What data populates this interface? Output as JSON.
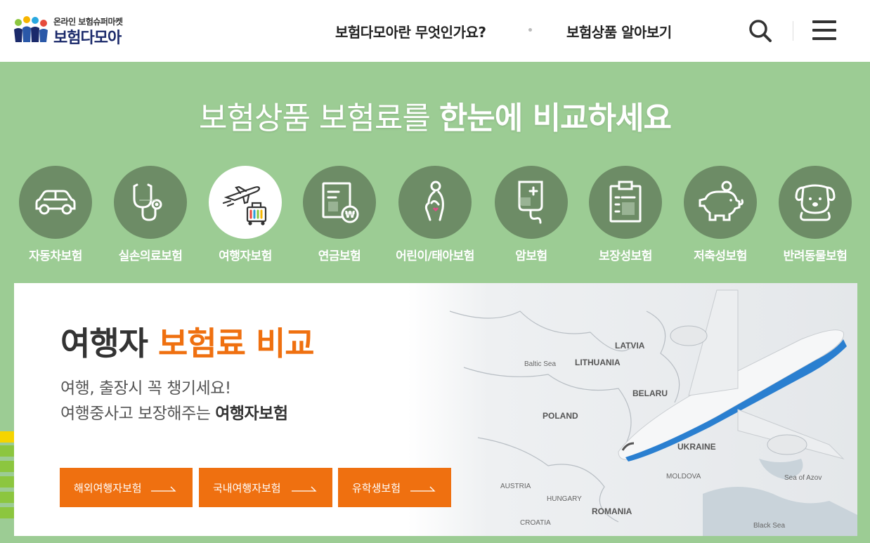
{
  "header": {
    "logo_sub": "온라인 보험슈퍼마켓",
    "logo_main": "보험다모아",
    "nav": [
      "보험다모아란 무엇인가요?",
      "보험상품 알아보기"
    ]
  },
  "hero": {
    "headline_light": "보험상품 보험료를 ",
    "headline_bold": "한눈에 비교하세요"
  },
  "categories": [
    {
      "label": "자동차보험",
      "icon": "car-icon"
    },
    {
      "label": "실손의료보험",
      "icon": "stethoscope-icon"
    },
    {
      "label": "여행자보험",
      "icon": "airplane-luggage-icon",
      "active": true
    },
    {
      "label": "연금보험",
      "icon": "pension-document-icon"
    },
    {
      "label": "어린이/태아보험",
      "icon": "pregnant-woman-icon"
    },
    {
      "label": "암보험",
      "icon": "iv-bag-icon"
    },
    {
      "label": "보장성보험",
      "icon": "clipboard-icon"
    },
    {
      "label": "저축성보험",
      "icon": "piggy-bank-icon"
    },
    {
      "label": "반려동물보험",
      "icon": "dog-icon"
    }
  ],
  "banner": {
    "title_dark": "여행자 ",
    "title_orange": "보험료 비교",
    "desc1": "여행, 출장시 꼭 챙기세요!",
    "desc2_plain": "여행중사고 보장해주는 ",
    "desc2_bold": "여행자보험",
    "buttons": [
      "해외여행자보험",
      "국내여행자보험",
      "유학생보험"
    ],
    "map_labels": [
      "LATVIA",
      "LITHUANIA",
      "BELARU",
      "POLAND",
      "UKRAINE",
      "Black Sea",
      "ROMANIA",
      "HUNGARY",
      "AUSTRIA",
      "Sea of Azov",
      "MOLDOVA",
      "Baltic Sea",
      "CROATIA"
    ]
  },
  "colors": {
    "background": "#9ccc94",
    "circle": "#6d8c66",
    "accent": "#ef7010",
    "logo_navy": "#1b2a6b"
  }
}
